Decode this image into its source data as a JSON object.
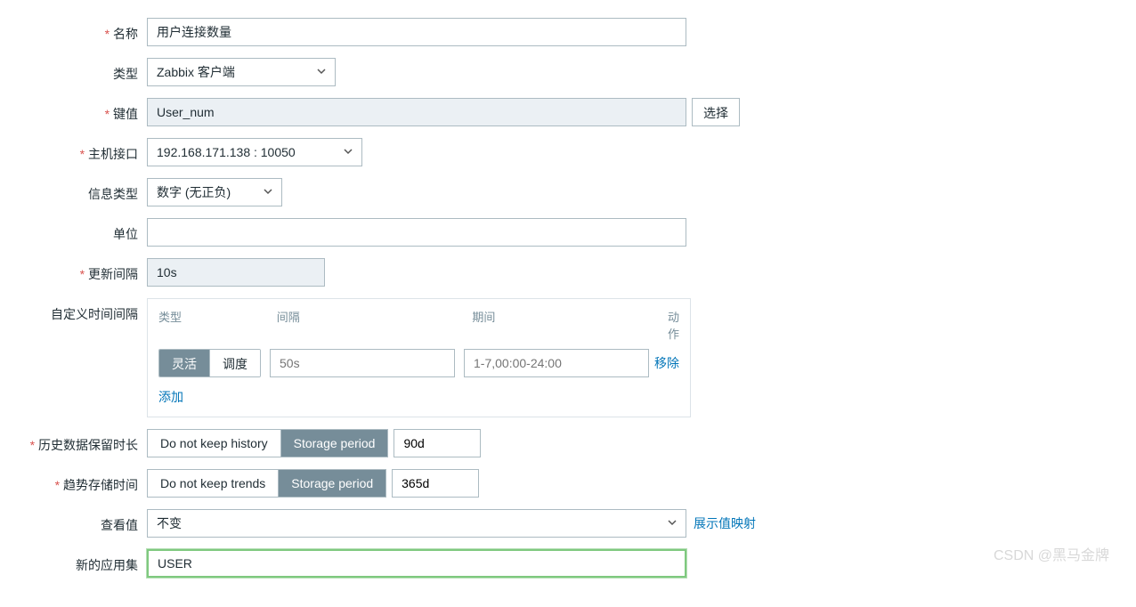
{
  "labels": {
    "name": "名称",
    "type": "类型",
    "key": "键值",
    "host_interface": "主机接口",
    "info_type": "信息类型",
    "units": "单位",
    "update_interval": "更新间隔",
    "custom_interval": "自定义时间间隔",
    "history_storage": "历史数据保留时长",
    "trend_storage": "趋势存储时间",
    "show_value": "查看值",
    "new_application": "新的应用集"
  },
  "values": {
    "name": "用户连接数量",
    "type": "Zabbix 客户端",
    "key": "User_num",
    "host_interface": "192.168.171.138 : 10050",
    "info_type": "数字 (无正负)",
    "units": "",
    "update_interval": "10s",
    "history_period": "90d",
    "trend_period": "365d",
    "show_value": "不变",
    "new_application": "USER"
  },
  "buttons": {
    "select": "选择",
    "show_value_map": "展示值映射"
  },
  "custom_interval": {
    "header_type": "类型",
    "header_interval": "间隔",
    "header_period": "期间",
    "header_action": "动作",
    "flexible": "灵活",
    "scheduling": "调度",
    "interval_placeholder": "50s",
    "period_placeholder": "1-7,00:00-24:00",
    "remove": "移除",
    "add": "添加"
  },
  "storage": {
    "do_not_keep_history": "Do not keep history",
    "do_not_keep_trends": "Do not keep trends",
    "storage_period": "Storage period"
  },
  "watermark": "CSDN @黑马金牌"
}
